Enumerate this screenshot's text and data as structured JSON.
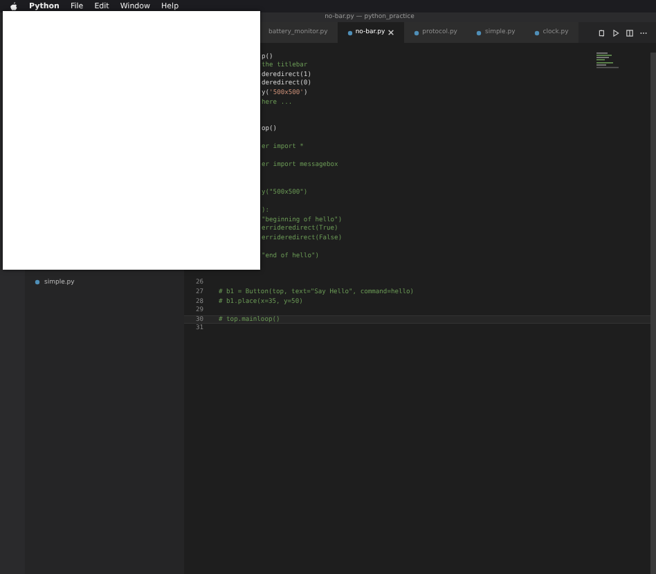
{
  "menu_bar": {
    "app": "Python",
    "items": [
      "File",
      "Edit",
      "Window",
      "Help"
    ]
  },
  "window": {
    "title": "no-bar.py — python_practice"
  },
  "sidebar": {
    "items": [
      {
        "label": "simple.py"
      }
    ]
  },
  "tabs": [
    {
      "label": "battery_monitor.py",
      "selected": false
    },
    {
      "label": "no-bar.py",
      "selected": true
    },
    {
      "label": "protocol.py",
      "selected": false
    },
    {
      "label": "simple.py",
      "selected": false
    },
    {
      "label": "clock.py",
      "selected": false
    }
  ],
  "code_lines": [
    {
      "kind": "covered",
      "current": false,
      "tokens": [
        {
          "t": "p()",
          "kind": "code"
        }
      ]
    },
    {
      "kind": "covered",
      "current": false,
      "tokens": [
        {
          "t": "the titlebar",
          "kind": "comment"
        }
      ]
    },
    {
      "kind": "covered",
      "current": false,
      "tokens": [
        {
          "t": "deredirect(1)",
          "kind": "code"
        }
      ]
    },
    {
      "kind": "covered",
      "current": false,
      "tokens": [
        {
          "t": "deredirect(0)",
          "kind": "code"
        }
      ]
    },
    {
      "kind": "covered",
      "current": false,
      "tokens": [
        {
          "t": "y(",
          "kind": "code"
        },
        {
          "t": "'500x500'",
          "kind": "string"
        },
        {
          "t": ")",
          "kind": "code"
        }
      ]
    },
    {
      "kind": "covered",
      "current": false,
      "tokens": [
        {
          "t": "here ...",
          "kind": "comment"
        }
      ]
    },
    {
      "kind": "covered",
      "current": false
    },
    {
      "kind": "covered",
      "current": false
    },
    {
      "kind": "covered",
      "current": false,
      "tokens": [
        {
          "t": "op()",
          "kind": "code"
        }
      ]
    },
    {
      "kind": "covered",
      "current": false
    },
    {
      "kind": "covered",
      "current": false,
      "tokens": [
        {
          "t": "er import *",
          "kind": "comment"
        }
      ]
    },
    {
      "kind": "covered",
      "current": false
    },
    {
      "kind": "covered",
      "current": false,
      "tokens": [
        {
          "t": "er import messagebox",
          "kind": "comment"
        }
      ]
    },
    {
      "kind": "covered",
      "current": false
    },
    {
      "kind": "covered",
      "current": false
    },
    {
      "kind": "covered",
      "current": false,
      "tokens": [
        {
          "t": "y(\"500x500\")",
          "kind": "comment"
        }
      ]
    },
    {
      "kind": "covered",
      "current": false
    },
    {
      "kind": "covered",
      "current": false,
      "tokens": [
        {
          "t": "):",
          "kind": "comment"
        }
      ]
    },
    {
      "kind": "covered",
      "current": false,
      "tokens": [
        {
          "t": "\"beginning of hello\")",
          "kind": "comment"
        }
      ]
    },
    {
      "kind": "covered",
      "current": false,
      "tokens": [
        {
          "t": "errideredirect(True)",
          "kind": "comment"
        }
      ]
    },
    {
      "kind": "covered",
      "current": false,
      "tokens": [
        {
          "t": "errideredirect(False)",
          "kind": "comment"
        }
      ]
    },
    {
      "kind": "covered",
      "current": false
    },
    {
      "kind": "covered",
      "current": false,
      "tokens": [
        {
          "t": "\"end of hello\")",
          "kind": "comment"
        }
      ]
    },
    {
      "kind": "covered",
      "current": false
    },
    {
      "kind": "covered",
      "current": false
    },
    {
      "kind": "full",
      "number": "26",
      "current": false
    },
    {
      "kind": "full",
      "number": "27",
      "current": false,
      "tokens": [
        {
          "t": "# b1 = Button(top, text=\"Say Hello\", command=hello)",
          "kind": "comment"
        }
      ]
    },
    {
      "kind": "full",
      "number": "28",
      "current": false,
      "tokens": [
        {
          "t": "# b1.place(x=35, y=50)",
          "kind": "comment"
        }
      ]
    },
    {
      "kind": "full",
      "number": "29",
      "current": false
    },
    {
      "kind": "full",
      "number": "30",
      "current": true,
      "tokens": [
        {
          "t": "# top.mainloop()",
          "kind": "comment"
        }
      ]
    },
    {
      "kind": "full",
      "number": "31",
      "current": false
    }
  ]
}
